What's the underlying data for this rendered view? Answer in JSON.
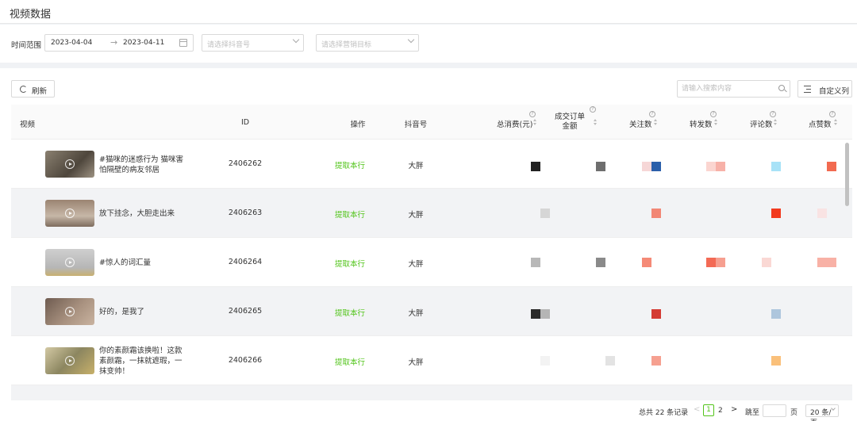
{
  "header": {
    "title": "视频数据"
  },
  "filters": {
    "time_label": "时间范围",
    "date_start": "2023-04-04",
    "date_arrow": "→",
    "date_end": "2023-04-11",
    "account_placeholder": "请选择抖音号",
    "target_placeholder": "请选择营销目标"
  },
  "toolbar": {
    "refresh_label": "刷新",
    "search_placeholder": "请输入搜索内容",
    "custom_columns_label": "自定义列"
  },
  "table": {
    "columns": {
      "video": "视频",
      "id": "ID",
      "action": "操作",
      "account": "抖音号",
      "total_cost": "总消费(元)",
      "order_amount": "成交订单金额",
      "follows": "关注数",
      "shares": "转发数",
      "comments": "评论数",
      "likes": "点赞数"
    },
    "rows": [
      {
        "title": "#猫咪的迷惑行为 猫咪害怕隔壁的病友邻居",
        "id": "2406262",
        "action": "提取本行",
        "account": "大胖"
      },
      {
        "title": "放下挂念，大胆走出来",
        "id": "2406263",
        "action": "提取本行",
        "account": "大胖"
      },
      {
        "title": "#惊人的词汇量",
        "id": "2406264",
        "action": "提取本行",
        "account": "大胖"
      },
      {
        "title": "好的，是我了",
        "id": "2406265",
        "action": "提取本行",
        "account": "大胖"
      },
      {
        "title": "你的素颜霜该换啦！这款素颜霜，一抹就遮瑕，一抹变帅！",
        "id": "2406266",
        "action": "提取本行",
        "account": "大胖"
      }
    ]
  },
  "colors": {
    "accent_green": "#52c41a",
    "thumb_1": "#6b6152",
    "thumb_2": "#a89480",
    "thumb_3": "#bdbdbd",
    "thumb_4": "#8a7466",
    "thumb_5": "#b2a77a"
  },
  "pagination": {
    "total_text": "总共 22 条记录",
    "prev": "<",
    "page_1": "1",
    "page_2": "2",
    "next": ">",
    "goto_label": "跳至",
    "goto_suffix": "页",
    "page_size": "20 条/页"
  }
}
